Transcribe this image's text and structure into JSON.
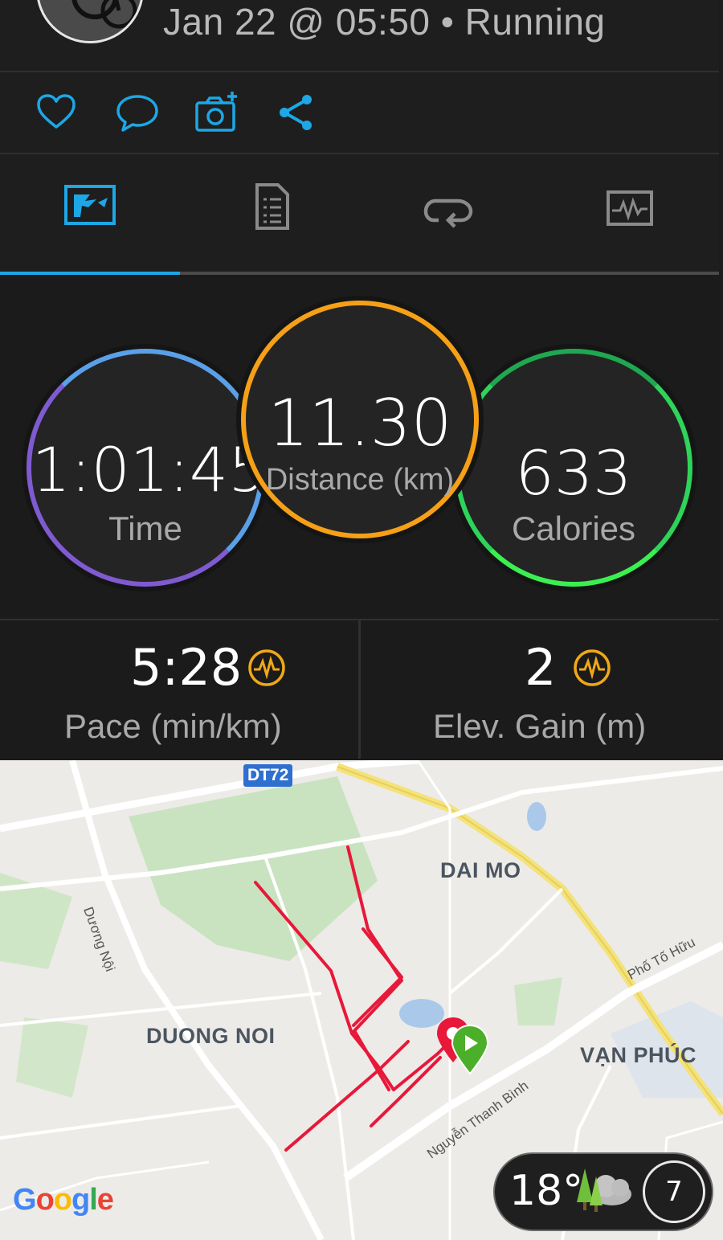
{
  "header": {
    "subtitle": "Jan 22 @ 05:50 • Running"
  },
  "actions": [
    {
      "name": "like",
      "icon": "heart-icon"
    },
    {
      "name": "comment",
      "icon": "comment-icon"
    },
    {
      "name": "add-photo",
      "icon": "add-photo-icon"
    },
    {
      "name": "share",
      "icon": "share-icon"
    }
  ],
  "tabs": [
    {
      "name": "overview",
      "icon": "overview-icon",
      "active": true
    },
    {
      "name": "stats",
      "icon": "document-list-icon",
      "active": false
    },
    {
      "name": "laps",
      "icon": "laps-loop-icon",
      "active": false
    },
    {
      "name": "charts",
      "icon": "chart-monitor-icon",
      "active": false
    }
  ],
  "rings": {
    "time": {
      "value": "1:01:45",
      "label": "Time"
    },
    "distance": {
      "value": "11.30",
      "label": "Distance (km)"
    },
    "calories": {
      "value": "633",
      "label": "Calories"
    }
  },
  "metrics": {
    "pace": {
      "value": "5:28",
      "label": "Pace (min/km)",
      "icon": "gauge-icon"
    },
    "elevation": {
      "value": "2",
      "label": "Elev. Gain (m)",
      "icon": "gauge-icon"
    }
  },
  "map": {
    "road_shield": "DT72",
    "areas": [
      "DAI MO",
      "DUONG NOI",
      "VẠN PHÚC"
    ],
    "streets": [
      "Dương Nội",
      "Phố Tố Hữu",
      "Nguyễn Thanh Bình"
    ],
    "attribution": "Google"
  },
  "weather": {
    "temperature": "18°",
    "icon": "cloud-tree-icon",
    "wind": "7"
  },
  "colors": {
    "accent": "#1da7e6",
    "time_ring": "#5aa0e8",
    "distance_ring": "#f5a017",
    "calories_ring": "#2ed45a",
    "track": "#e8183a",
    "gauge": "#f0a818"
  }
}
